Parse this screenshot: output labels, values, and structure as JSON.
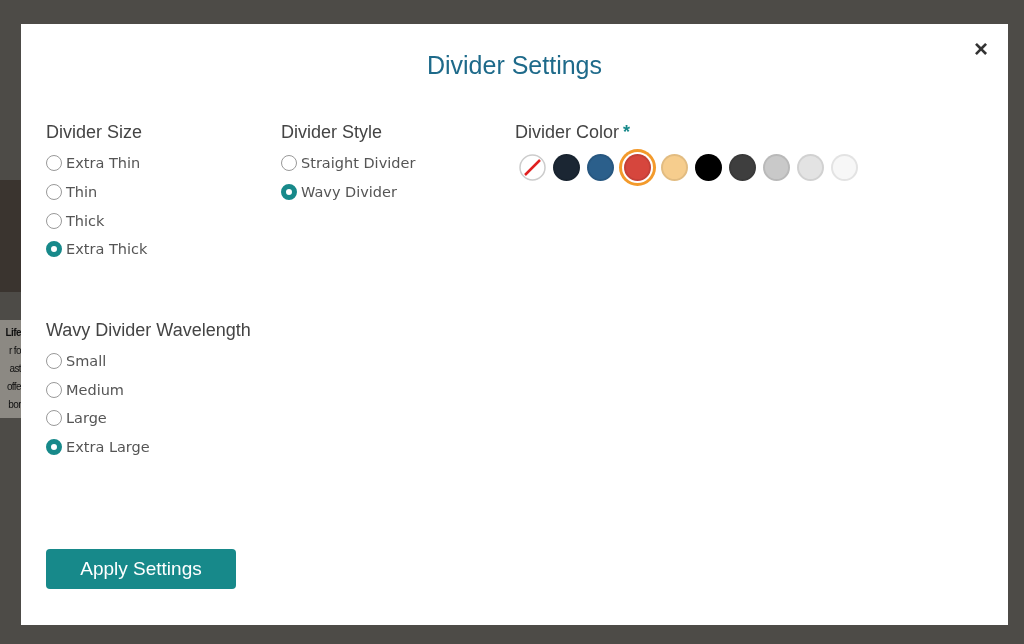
{
  "background": {
    "text_fragments": [
      "Life",
      "r fo",
      "ast",
      "offe",
      "bor"
    ]
  },
  "dialog": {
    "title": "Divider Settings",
    "close": "×"
  },
  "size": {
    "label": "Divider Size",
    "options": [
      {
        "label": "Extra Thin",
        "selected": false
      },
      {
        "label": "Thin",
        "selected": false
      },
      {
        "label": "Thick",
        "selected": false
      },
      {
        "label": "Extra Thick",
        "selected": true
      }
    ]
  },
  "style": {
    "label": "Divider Style",
    "options": [
      {
        "label": "Straight Divider",
        "selected": false
      },
      {
        "label": "Wavy Divider",
        "selected": true
      }
    ]
  },
  "color": {
    "label": "Divider Color",
    "required_mark": "*",
    "swatches": [
      {
        "kind": "none",
        "selected": false
      },
      {
        "kind": "solid",
        "color": "#1b2633",
        "selected": false
      },
      {
        "kind": "solid",
        "color": "#2b5f8b",
        "selected": false
      },
      {
        "kind": "solid",
        "color": "#d6463d",
        "selected": true
      },
      {
        "kind": "solid",
        "color": "#f6cd8d",
        "selected": false
      },
      {
        "kind": "solid",
        "color": "#000000",
        "selected": false
      },
      {
        "kind": "solid",
        "color": "#3e3e3e",
        "selected": false
      },
      {
        "kind": "solid",
        "color": "#c9c9c9",
        "selected": false
      },
      {
        "kind": "solid",
        "color": "#e3e3e3",
        "selected": false
      },
      {
        "kind": "solid",
        "color": "#f7f7f7",
        "selected": false
      }
    ]
  },
  "wavelength": {
    "label": "Wavy Divider Wavelength",
    "options": [
      {
        "label": "Small",
        "selected": false
      },
      {
        "label": "Medium",
        "selected": false
      },
      {
        "label": "Large",
        "selected": false
      },
      {
        "label": "Extra Large",
        "selected": true
      }
    ]
  },
  "apply_button": "Apply Settings"
}
